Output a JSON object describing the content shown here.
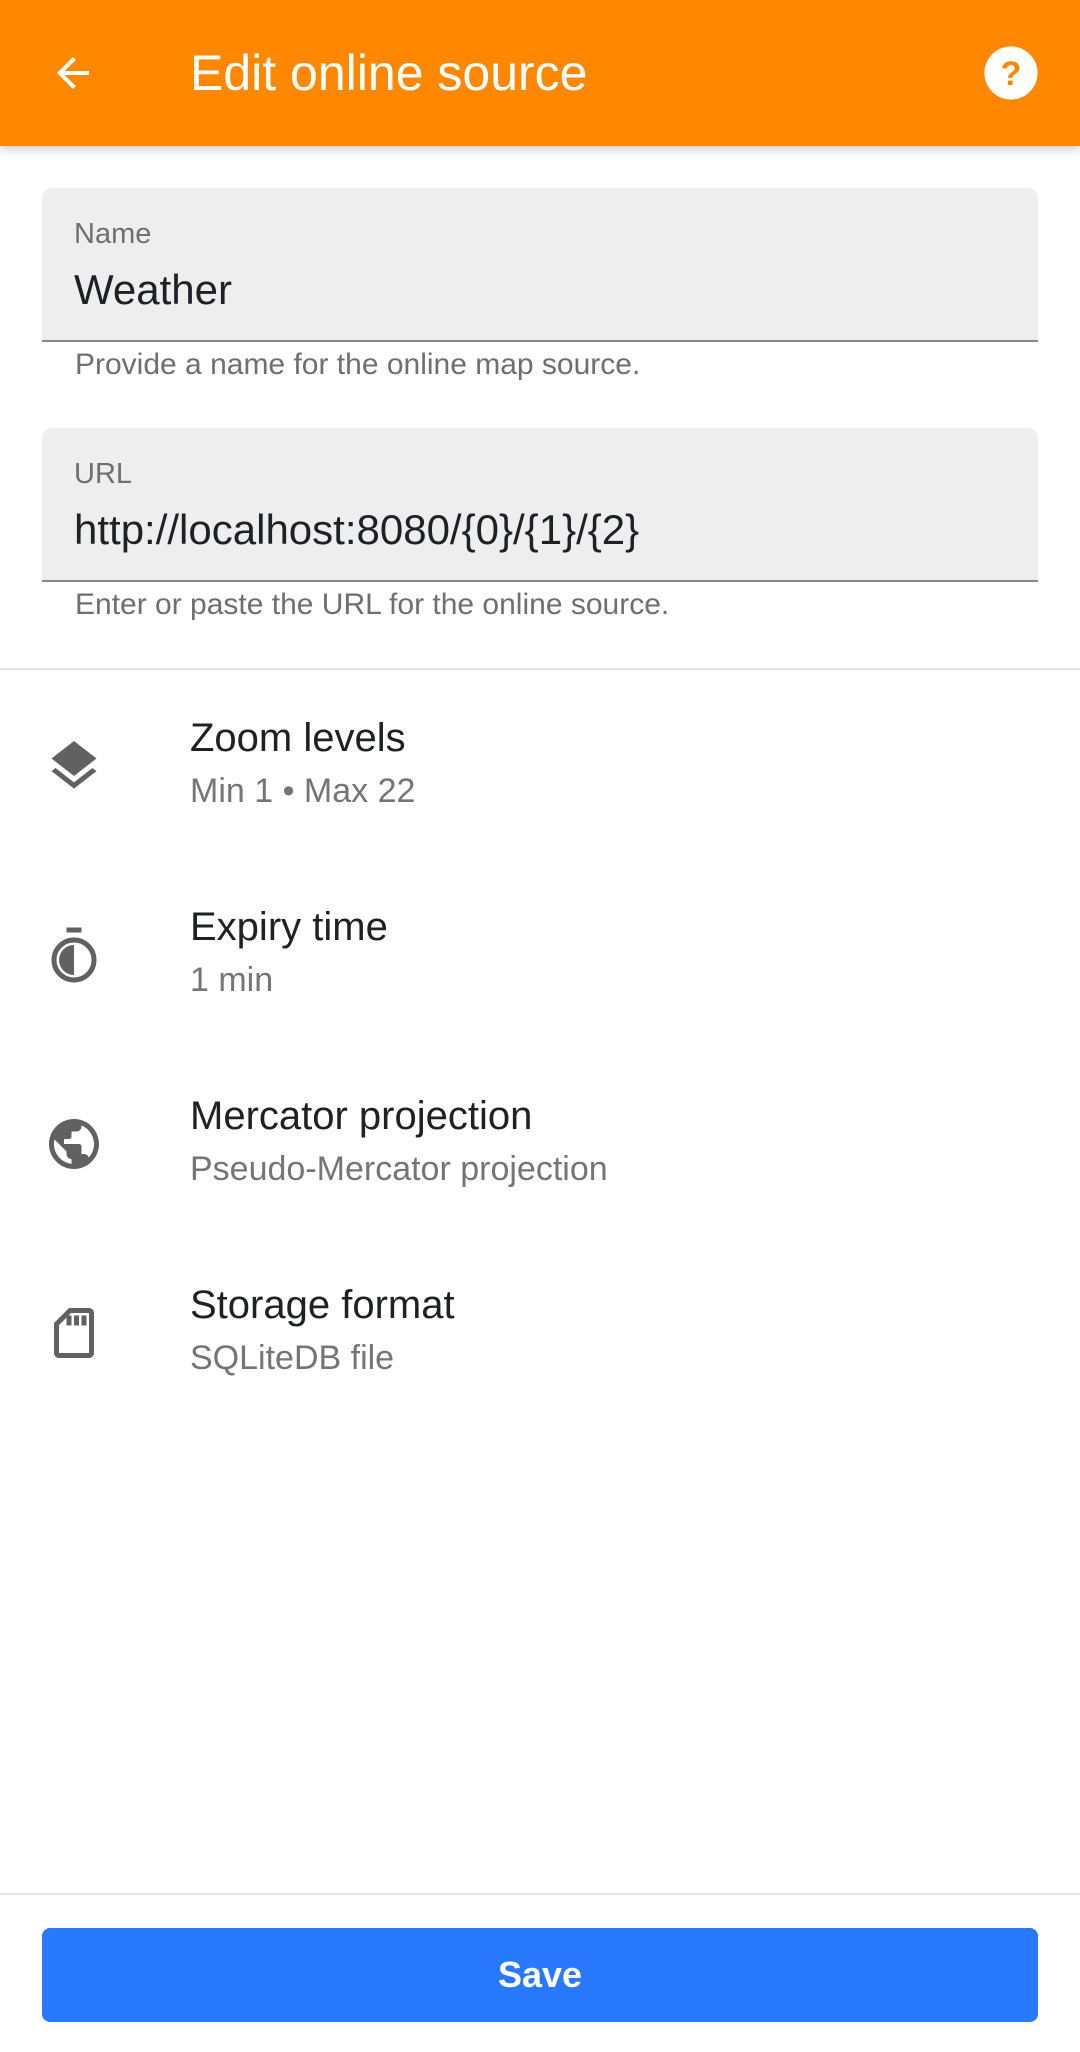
{
  "appbar": {
    "title": "Edit online source",
    "back_icon": "arrow-back-icon",
    "help_icon": "help-circle-icon",
    "color": "#ff8800"
  },
  "name_field": {
    "label": "Name",
    "value": "Weather",
    "helper": "Provide a name for the online map source."
  },
  "url_field": {
    "label": "URL",
    "value": "http://localhost:8080/{0}/{1}/{2}",
    "helper": "Enter or paste the URL for the online source."
  },
  "settings": [
    {
      "icon": "layers-icon",
      "title": "Zoom levels",
      "subtitle": "Min 1 • Max 22"
    },
    {
      "icon": "timer-icon",
      "title": "Expiry time",
      "subtitle": "1 min"
    },
    {
      "icon": "globe-icon",
      "title": "Mercator projection",
      "subtitle": "Pseudo-Mercator projection"
    },
    {
      "icon": "sd-card-icon",
      "title": "Storage format",
      "subtitle": "SQLiteDB file"
    }
  ],
  "footer": {
    "save_label": "Save",
    "save_color": "#2979ff"
  }
}
